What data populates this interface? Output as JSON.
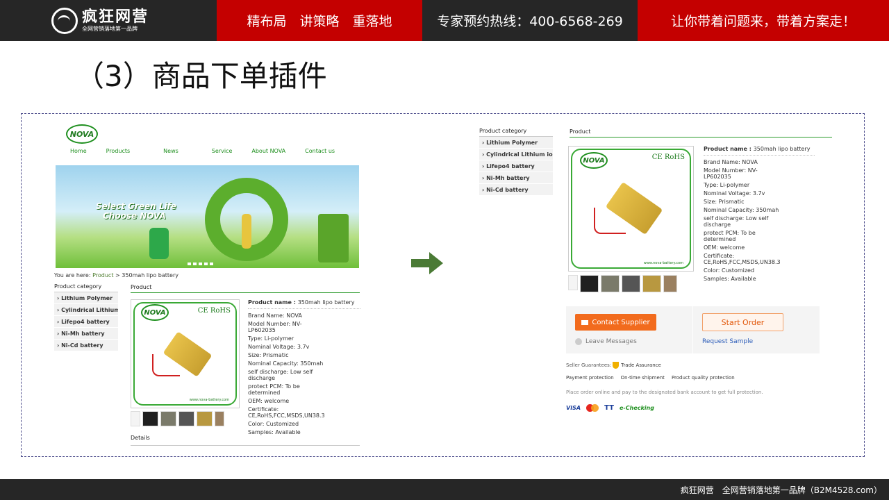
{
  "header": {
    "logo_main": "疯狂网营",
    "logo_sub": "全网营销落地第一品牌",
    "slogan": "精布局　讲策略　重落地",
    "hotline": "专家预约热线：400-6568-269",
    "tagline": "让你带着问题来，带着方案走！"
  },
  "page_title": "（3）商品下单插件",
  "left_shot": {
    "logo": "NOVA",
    "nav": [
      "Home",
      "Products",
      "News",
      "Service",
      "About NOVA",
      "Contact us"
    ],
    "banner_line1": "Select Green Life",
    "banner_line2": "Choose NOVA",
    "crumb_prefix": "You are here:",
    "crumb_link": "Product",
    "crumb_rest": "> 350mah lipo battery",
    "category_head": "Product category",
    "categories": [
      "› Lithium Polymer",
      "› Cylindrical Lithium ion",
      "› Lifepo4 battery",
      "› Ni-Mh battery",
      "› Ni-Cd battery"
    ],
    "product_head": "Product",
    "details": "Details"
  },
  "right_shot": {
    "category_head": "Product category",
    "categories": [
      "› Lithium Polymer",
      "› Cylindrical Lithium ion",
      "› Lifepo4 battery",
      "› Ni-Mh battery",
      "› Ni-Cd battery"
    ],
    "product_head": "Product",
    "contact_btn": "Contact Supplier",
    "leave_msg": "Leave Messages",
    "start_order": "Start Order",
    "request_sample": "Request Sample",
    "guarantee_label": "Seller Guarantees:",
    "trade_assurance": "Trade Assurance",
    "guarantees": [
      "Payment protection",
      "On-time shipment",
      "Product quality protection"
    ],
    "place_order": "Place order online and pay to the designated bank account to get full protection.",
    "pay_visa": "VISA",
    "pay_tt": "TT",
    "pay_echeck": "e-Checking"
  },
  "product": {
    "name_label": "Product name :",
    "name_value": "350mah lipo battery",
    "cert_mark": "CE RoHS",
    "image_url_text": "www.nova-battery.com",
    "specs": [
      "Brand Name: NOVA",
      "Model Number: NV-LP602035",
      "Type: Li-polymer",
      "Nominal Voltage: 3.7v",
      "Size: Prismatic",
      "Nominal Capacity: 350mah",
      "self discharge: Low self discharge",
      "protect PCM: To be determined",
      "OEM: welcome",
      "Certificate: CE,RoHS,FCC,MSDS,UN38.3",
      "Color: Customized",
      "Samples: Available"
    ]
  },
  "footer": "疯狂网营　全网营销落地第一品牌（B2M4528.com）",
  "colors": {
    "brand_red": "#c40000",
    "dark": "#262626",
    "nova_green": "#39a935",
    "arrow": "#4a7a35",
    "order_orange": "#f26b1d"
  }
}
